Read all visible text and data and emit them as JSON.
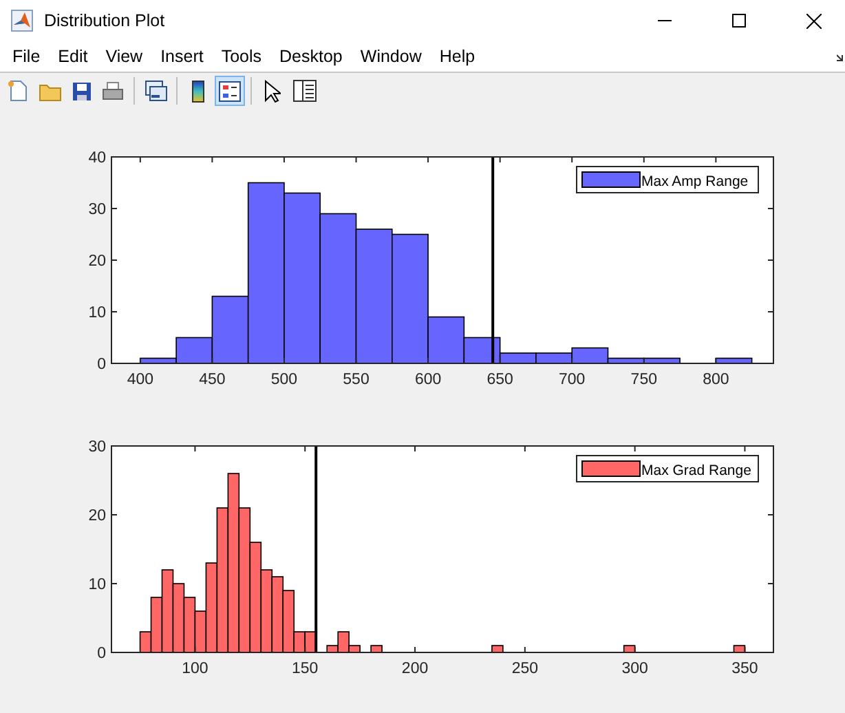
{
  "window": {
    "title": "Distribution Plot"
  },
  "menu": [
    "File",
    "Edit",
    "View",
    "Insert",
    "Tools",
    "Desktop",
    "Window",
    "Help"
  ],
  "toolbar": [
    {
      "kind": "new",
      "selected": false
    },
    {
      "kind": "open",
      "selected": false
    },
    {
      "kind": "save",
      "selected": false
    },
    {
      "kind": "print",
      "selected": false
    },
    {
      "kind": "separator"
    },
    {
      "kind": "link",
      "selected": false
    },
    {
      "kind": "separator"
    },
    {
      "kind": "colorbar",
      "selected": false
    },
    {
      "kind": "legend",
      "selected": true
    },
    {
      "kind": "separator"
    },
    {
      "kind": "pointer",
      "selected": false
    },
    {
      "kind": "inspector",
      "selected": false
    }
  ],
  "plots": [
    {
      "chart_data": {
        "type": "bar",
        "x": [
          412.5,
          437.5,
          462.5,
          487.5,
          512.5,
          537.5,
          562.5,
          587.5,
          612.5,
          637.5,
          662.5,
          687.5,
          712.5,
          737.5,
          762.5,
          812.5
        ],
        "series": [
          {
            "name": "Max Amp Range",
            "color": "#6666ff",
            "values": [
              1,
              5,
              13,
              35,
              33,
              29,
              26,
              25,
              9,
              5,
              2,
              2,
              3,
              1,
              1,
              1
            ]
          }
        ],
        "xlim": [
          380,
          840
        ],
        "ylim": [
          0,
          40
        ],
        "xticks": [
          400,
          450,
          500,
          550,
          600,
          650,
          700,
          750,
          800
        ],
        "yticks": [
          0,
          10,
          20,
          30,
          40
        ],
        "ref_lines": [
          {
            "axis": "x",
            "value": 645
          }
        ]
      }
    },
    {
      "chart_data": {
        "type": "bar",
        "x": [
          77.5,
          82.5,
          87.5,
          92.5,
          97.5,
          102.5,
          107.5,
          112.5,
          117.5,
          122.5,
          127.5,
          132.5,
          137.5,
          142.5,
          147.5,
          152.5,
          162.5,
          167.5,
          172.5,
          182.5,
          237.5,
          297.5,
          347.5
        ],
        "series": [
          {
            "name": "Max Grad Range",
            "color": "#ff6666",
            "values": [
              3,
              8,
              12,
              10,
              8,
              6,
              13,
              21,
              26,
              21,
              16,
              12,
              11,
              9,
              3,
              3,
              1,
              3,
              1,
              1,
              1,
              1,
              1
            ]
          }
        ],
        "xlim": [
          62,
          363
        ],
        "ylim": [
          0,
          30
        ],
        "xticks": [
          100,
          150,
          200,
          250,
          300,
          350
        ],
        "yticks": [
          0,
          10,
          20,
          30
        ],
        "ref_lines": [
          {
            "axis": "x",
            "value": 155
          }
        ]
      }
    }
  ]
}
